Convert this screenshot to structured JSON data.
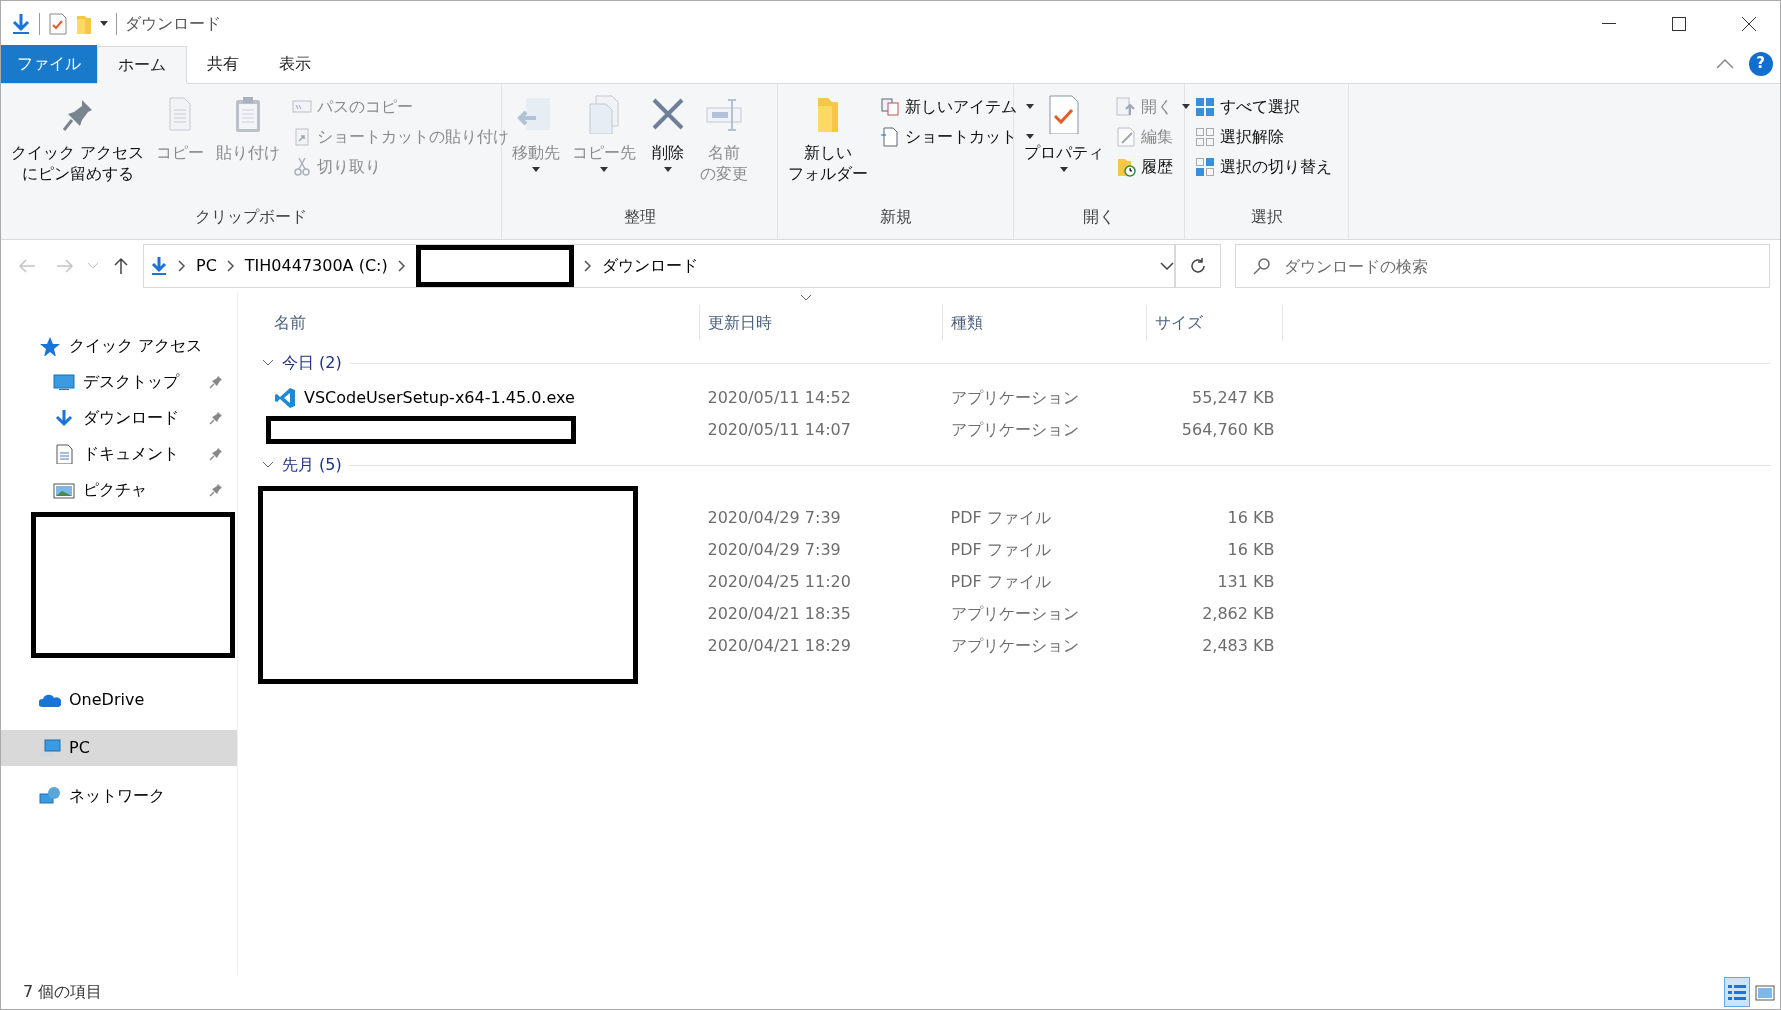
{
  "window": {
    "title": "ダウンロード"
  },
  "ribbon": {
    "tabs": [
      {
        "label": "ファイル",
        "kind": "file",
        "selected": false
      },
      {
        "label": "ホーム",
        "kind": "tab",
        "selected": true
      },
      {
        "label": "共有",
        "kind": "tab",
        "selected": false
      },
      {
        "label": "表示",
        "kind": "tab",
        "selected": false
      }
    ],
    "help": "?",
    "groups": [
      {
        "label": "クリップボード",
        "items": [
          {
            "kind": "large",
            "lines": [
              "クイック アクセス",
              "にピン留めする"
            ],
            "disabled": false,
            "dropdown": false
          },
          {
            "kind": "large",
            "lines": [
              "コピー"
            ],
            "disabled": true,
            "dropdown": false
          },
          {
            "kind": "large",
            "lines": [
              "貼り付け"
            ],
            "disabled": true,
            "dropdown": false
          },
          {
            "kind": "small",
            "lines": [
              "パスのコピー"
            ],
            "disabled": true,
            "dropdown": false
          },
          {
            "kind": "small",
            "lines": [
              "ショートカットの貼り付け"
            ],
            "disabled": true,
            "dropdown": false
          },
          {
            "kind": "small",
            "lines": [
              "切り取り"
            ],
            "disabled": true,
            "dropdown": false
          }
        ]
      },
      {
        "label": "整理",
        "items": [
          {
            "kind": "large",
            "lines": [
              "移動先"
            ],
            "disabled": true,
            "dropdown": true
          },
          {
            "kind": "large",
            "lines": [
              "コピー先"
            ],
            "disabled": true,
            "dropdown": true
          },
          {
            "kind": "large",
            "lines": [
              "削除"
            ],
            "disabled": false,
            "dropdown": true
          },
          {
            "kind": "large",
            "lines": [
              "名前",
              "の変更"
            ],
            "disabled": true,
            "dropdown": false
          }
        ]
      },
      {
        "label": "新規",
        "items": [
          {
            "kind": "large",
            "lines": [
              "新しい",
              "フォルダー"
            ],
            "disabled": false,
            "dropdown": false
          },
          {
            "kind": "small",
            "lines": [
              "新しいアイテム"
            ],
            "disabled": false,
            "dropdown": true
          },
          {
            "kind": "small",
            "lines": [
              "ショートカット"
            ],
            "disabled": false,
            "dropdown": true
          }
        ]
      },
      {
        "label": "開く",
        "items": [
          {
            "kind": "large",
            "lines": [
              "プロパティ"
            ],
            "disabled": false,
            "dropdown": true
          },
          {
            "kind": "small",
            "lines": [
              "開く"
            ],
            "disabled": true,
            "dropdown": true
          },
          {
            "kind": "small",
            "lines": [
              "編集"
            ],
            "disabled": true,
            "dropdown": false
          },
          {
            "kind": "small",
            "lines": [
              "履歴"
            ],
            "disabled": false,
            "dropdown": false
          }
        ]
      },
      {
        "label": "選択",
        "items": [
          {
            "kind": "small",
            "lines": [
              "すべて選択"
            ],
            "disabled": false,
            "dropdown": false
          },
          {
            "kind": "small",
            "lines": [
              "選択解除"
            ],
            "disabled": false,
            "dropdown": false
          },
          {
            "kind": "small",
            "lines": [
              "選択の切り替え"
            ],
            "disabled": false,
            "dropdown": false
          }
        ]
      }
    ]
  },
  "address_bar": {
    "history_buttons": [
      {
        "disabled": true
      },
      {
        "disabled": true
      },
      {
        "disabled": false
      }
    ],
    "segments": [
      {
        "kind": "text",
        "label": "PC"
      },
      {
        "kind": "text",
        "label": "TIH0447300A (C:)"
      },
      {
        "kind": "redacted"
      },
      {
        "kind": "text",
        "label": "ダウンロード"
      }
    ],
    "search": {
      "placeholder": "ダウンロードの検索"
    }
  },
  "sidebar": {
    "items": [
      {
        "kind": "item",
        "label": "クイック アクセス",
        "selected": false,
        "children": [
          {
            "label": "デスクトップ",
            "pinned": true
          },
          {
            "label": "ダウンロード",
            "pinned": true
          },
          {
            "label": "ドキュメント",
            "pinned": true
          },
          {
            "label": "ピクチャ",
            "pinned": true
          }
        ]
      },
      {
        "kind": "redacted"
      },
      {
        "kind": "item",
        "label": "OneDrive",
        "selected": false
      },
      {
        "kind": "item",
        "label": "PC",
        "selected": true
      },
      {
        "kind": "item",
        "label": "ネットワーク",
        "selected": false
      }
    ]
  },
  "file_list": {
    "columns": [
      {
        "label": "名前",
        "sorted": false
      },
      {
        "label": "更新日時",
        "sorted": true
      },
      {
        "label": "種類",
        "sorted": false
      },
      {
        "label": "サイズ",
        "sorted": false
      }
    ],
    "groups": [
      {
        "label": "今日 (2)",
        "expanded": true,
        "names_redacted": false,
        "rows": [
          {
            "name": "VSCodeUserSetup-x64-1.45.0.exe",
            "name_redacted": false,
            "date": "2020/05/11 14:52",
            "type": "アプリケーション",
            "size": "55,247 KB"
          },
          {
            "name_redacted": true,
            "date": "2020/05/11 14:07",
            "type": "アプリケーション",
            "size": "564,760 KB"
          }
        ]
      },
      {
        "label": "先月 (5)",
        "expanded": true,
        "names_redacted": true,
        "rows": [
          {
            "date": "2020/04/29 7:39",
            "type": "PDF ファイル",
            "size": "16 KB"
          },
          {
            "date": "2020/04/29 7:39",
            "type": "PDF ファイル",
            "size": "16 KB"
          },
          {
            "date": "2020/04/25 11:20",
            "type": "PDF ファイル",
            "size": "131 KB"
          },
          {
            "date": "2020/04/21 18:35",
            "type": "アプリケーション",
            "size": "2,862 KB"
          },
          {
            "date": "2020/04/21 18:29",
            "type": "アプリケーション",
            "size": "2,483 KB"
          }
        ]
      }
    ]
  },
  "status_bar": {
    "text": "7 個の項目",
    "views": [
      {
        "selected": true
      },
      {
        "selected": false
      }
    ]
  }
}
